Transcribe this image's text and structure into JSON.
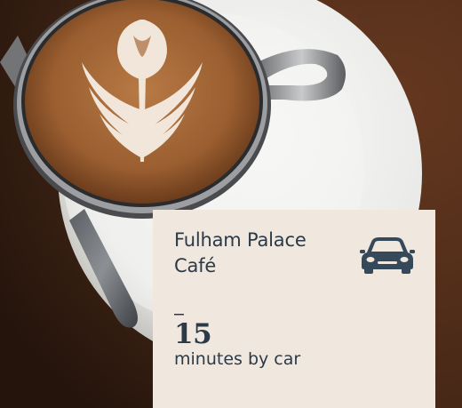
{
  "colors": {
    "card_background": "#f0e8df",
    "text": "#2c3a47",
    "icon": "#36495a"
  },
  "card": {
    "place_name": "Fulham Palace Café",
    "icon": "car-icon",
    "separator": "–",
    "duration_value": "15",
    "duration_unit": "minutes by car"
  }
}
